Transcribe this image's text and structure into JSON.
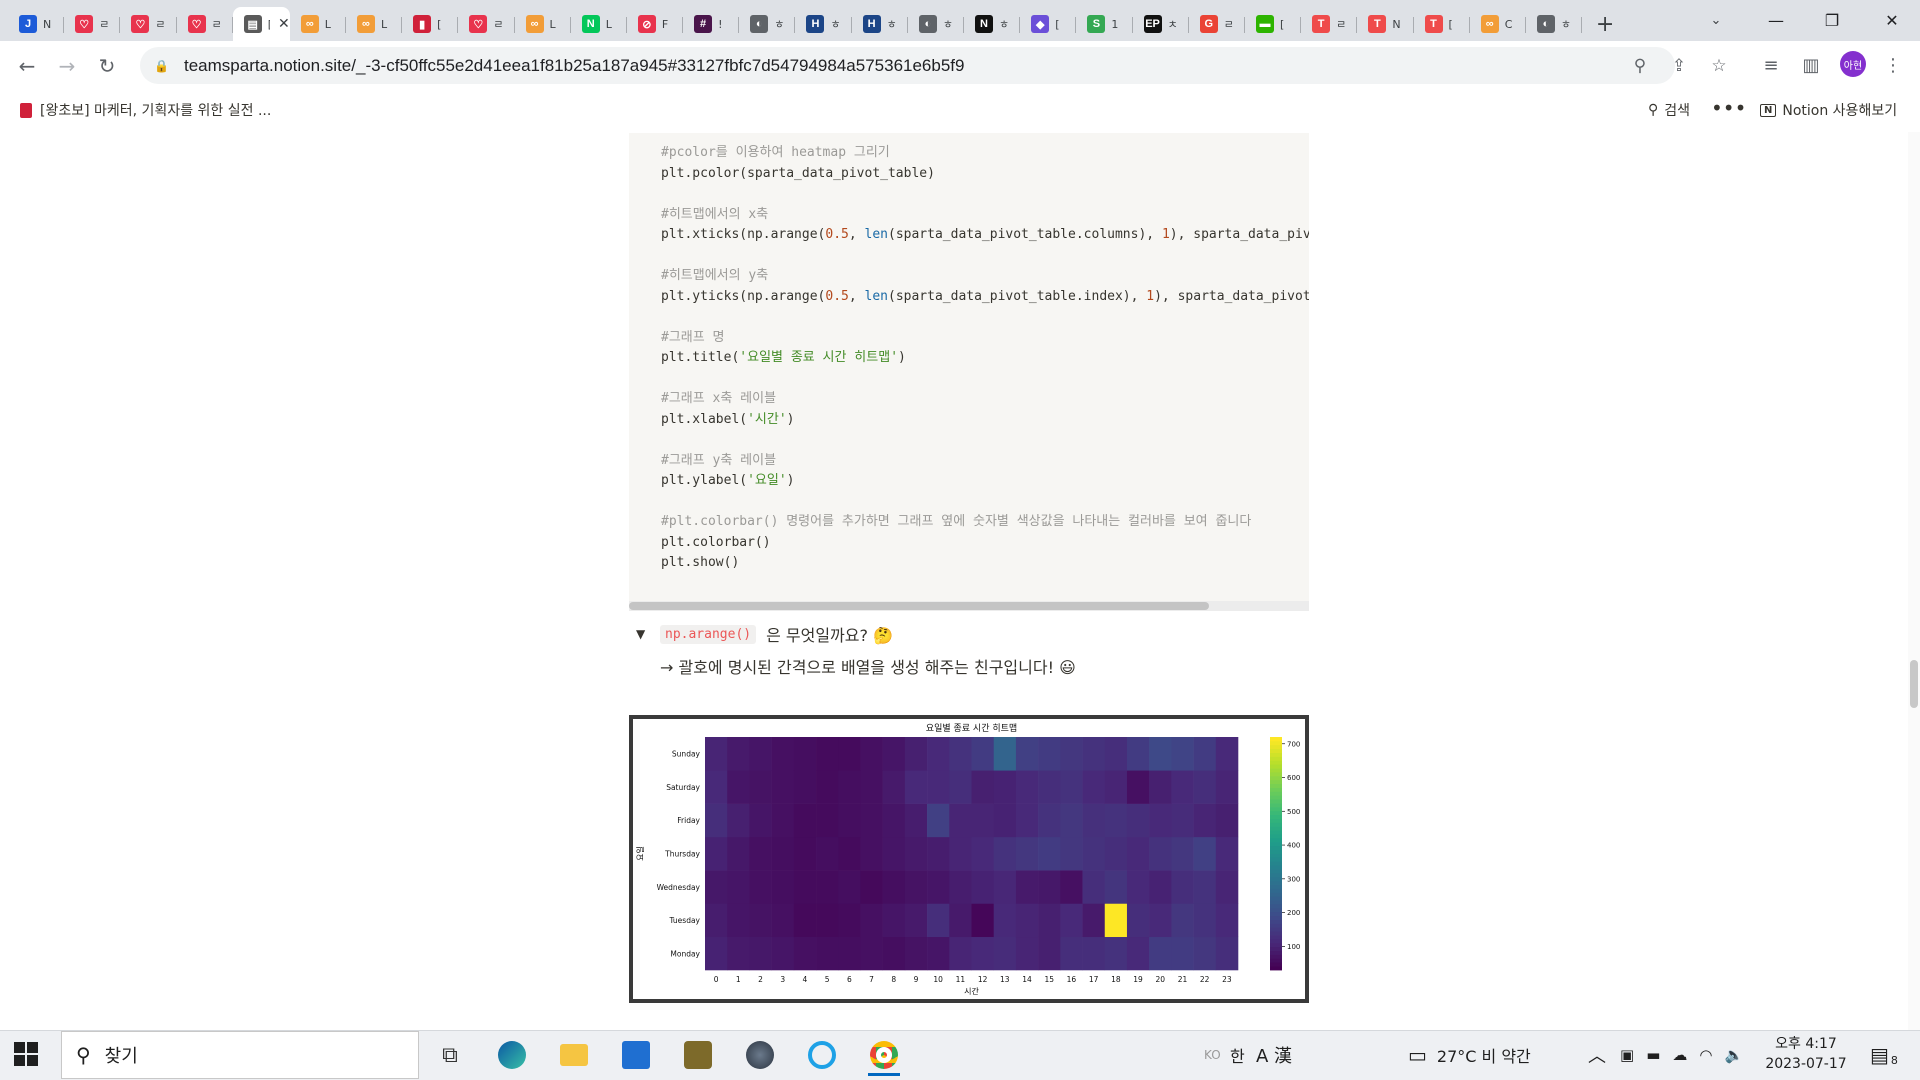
{
  "browser": {
    "tabs": [
      {
        "label": "N",
        "favicon": "J",
        "color": "#1d5bd8",
        "active": false
      },
      {
        "label": "ㄹ",
        "favicon": "♡",
        "color": "#e8334d",
        "active": false
      },
      {
        "label": "ㄹ",
        "favicon": "♡",
        "color": "#e8334d",
        "active": false
      },
      {
        "label": "ㄹ",
        "favicon": "♡",
        "color": "#e8334d",
        "active": false
      },
      {
        "label": "[왕",
        "favicon": "▤",
        "color": "#5a5a5a",
        "active": true
      },
      {
        "label": "L",
        "favicon": "∞",
        "color": "#f29d38",
        "active": false
      },
      {
        "label": "L",
        "favicon": "∞",
        "color": "#f29d38",
        "active": false
      },
      {
        "label": "[",
        "favicon": "▮",
        "color": "#d0213a",
        "active": false
      },
      {
        "label": "ㄹ",
        "favicon": "♡",
        "color": "#e8334d",
        "active": false
      },
      {
        "label": "L",
        "favicon": "∞",
        "color": "#f29d38",
        "active": false
      },
      {
        "label": "L",
        "favicon": "N",
        "color": "#03c75a",
        "active": false
      },
      {
        "label": "F",
        "favicon": "⊘",
        "color": "#e8334d",
        "active": false
      },
      {
        "label": "!",
        "favicon": "#",
        "color": "#4a154b",
        "active": false
      },
      {
        "label": "ㅎ",
        "favicon": "◐",
        "color": "#5f6368",
        "active": false
      },
      {
        "label": "ㅎ",
        "favicon": "H",
        "color": "#1c4587",
        "active": false
      },
      {
        "label": "ㅎ",
        "favicon": "H",
        "color": "#1c4587",
        "active": false
      },
      {
        "label": "ㅎ",
        "favicon": "◐",
        "color": "#5f6368",
        "active": false
      },
      {
        "label": "ㅎ",
        "favicon": "N",
        "color": "#111111",
        "active": false
      },
      {
        "label": "[",
        "favicon": "◆",
        "color": "#6b4fd8",
        "active": false
      },
      {
        "label": "1",
        "favicon": "S",
        "color": "#34a853",
        "active": false
      },
      {
        "label": "ㅊ",
        "favicon": "EP",
        "color": "#111111",
        "active": false
      },
      {
        "label": "ㄹ",
        "favicon": "G",
        "color": "#ea4335",
        "active": false
      },
      {
        "label": "[",
        "favicon": "▬",
        "color": "#2db400",
        "active": false
      },
      {
        "label": "ㄹ",
        "favicon": "T",
        "color": "#ef4b4b",
        "active": false
      },
      {
        "label": "N",
        "favicon": "T",
        "color": "#ef4b4b",
        "active": false
      },
      {
        "label": "[",
        "favicon": "T",
        "color": "#ef4b4b",
        "active": false
      },
      {
        "label": "C",
        "favicon": "∞",
        "color": "#f29d38",
        "active": false
      },
      {
        "label": "ㅎ",
        "favicon": "◐",
        "color": "#5f6368",
        "active": false
      }
    ],
    "url": "teamsparta.notion.site/_-3-cf50ffc55e2d41eea1f81b25a187a945#33127fbfc7d54794984a575361e6b5f9",
    "profile_initials": "아현"
  },
  "notion": {
    "breadcrumb": "[왕초보] 마케터, 기획자를 위한 실전 ...",
    "search_label": "검색",
    "try_notion_label": "Notion 사용해보기"
  },
  "code": {
    "lines": [
      [
        {
          "t": "#pcolor를 이용하여 heatmap 그리기",
          "c": "cm"
        }
      ],
      [
        {
          "t": "plt.pcolor(sparta_data_pivot_table)",
          "c": ""
        }
      ],
      [],
      [
        {
          "t": "#히트맵에서의 x축",
          "c": "cm"
        }
      ],
      [
        {
          "t": "plt.xticks(np.arange(",
          "c": ""
        },
        {
          "t": "0.5",
          "c": "num"
        },
        {
          "t": ", ",
          "c": ""
        },
        {
          "t": "len",
          "c": "fn"
        },
        {
          "t": "(sparta_data_pivot_table.columns), ",
          "c": ""
        },
        {
          "t": "1",
          "c": "num"
        },
        {
          "t": "), sparta_data_pivot_table.columns)",
          "c": ""
        }
      ],
      [],
      [
        {
          "t": "#히트맵에서의 y축",
          "c": "cm"
        }
      ],
      [
        {
          "t": "plt.yticks(np.arange(",
          "c": ""
        },
        {
          "t": "0.5",
          "c": "num"
        },
        {
          "t": ", ",
          "c": ""
        },
        {
          "t": "len",
          "c": "fn"
        },
        {
          "t": "(sparta_data_pivot_table.index), ",
          "c": ""
        },
        {
          "t": "1",
          "c": "num"
        },
        {
          "t": "), sparta_data_pivot_table.index)",
          "c": ""
        }
      ],
      [],
      [
        {
          "t": "#그래프 명",
          "c": "cm"
        }
      ],
      [
        {
          "t": "plt.title(",
          "c": ""
        },
        {
          "t": "'요일별 종료 시간 히트맵'",
          "c": "str"
        },
        {
          "t": ")",
          "c": ""
        }
      ],
      [],
      [
        {
          "t": "#그래프 x축 레이블",
          "c": "cm"
        }
      ],
      [
        {
          "t": "plt.xlabel(",
          "c": ""
        },
        {
          "t": "'시간'",
          "c": "str"
        },
        {
          "t": ")",
          "c": ""
        }
      ],
      [],
      [
        {
          "t": "#그래프 y축 레이블",
          "c": "cm"
        }
      ],
      [
        {
          "t": "plt.ylabel(",
          "c": ""
        },
        {
          "t": "'요일'",
          "c": "str"
        },
        {
          "t": ")",
          "c": ""
        }
      ],
      [],
      [
        {
          "t": "#plt.colorbar() 명령어를 추가하면 그래프 옆에 숫자별 색상값을 나타내는 컬러바를 보여 줍니다",
          "c": "cm"
        }
      ],
      [
        {
          "t": "plt.colorbar()",
          "c": ""
        }
      ],
      [
        {
          "t": "plt.show()",
          "c": ""
        }
      ]
    ]
  },
  "toggle": {
    "code_label": "np.arange()",
    "question": "은 무엇일까요? 🤔",
    "answer": "→ 괄호에 명시된 간격으로 배열을 생성 해주는 친구입니다! 😃"
  },
  "chart_data": {
    "type": "heatmap",
    "title": "요일별 종료 시간 히트맵",
    "xlabel": "시간",
    "ylabel": "요일",
    "x": [
      "0",
      "1",
      "2",
      "3",
      "4",
      "5",
      "6",
      "7",
      "8",
      "9",
      "10",
      "11",
      "12",
      "13",
      "14",
      "15",
      "16",
      "17",
      "18",
      "19",
      "20",
      "21",
      "22",
      "23"
    ],
    "y": [
      "Monday",
      "Tuesday",
      "Wednesday",
      "Thursday",
      "Friday",
      "Saturday",
      "Sunday"
    ],
    "values": [
      [
        95,
        80,
        75,
        70,
        60,
        55,
        55,
        60,
        55,
        65,
        70,
        100,
        110,
        115,
        100,
        90,
        120,
        120,
        130,
        110,
        150,
        150,
        140,
        120
      ],
      [
        85,
        70,
        65,
        60,
        45,
        45,
        50,
        60,
        70,
        80,
        120,
        80,
        40,
        110,
        100,
        90,
        110,
        80,
        720,
        120,
        110,
        140,
        130,
        110
      ],
      [
        75,
        70,
        60,
        55,
        50,
        50,
        55,
        45,
        55,
        65,
        70,
        85,
        95,
        105,
        80,
        75,
        60,
        120,
        135,
        110,
        95,
        120,
        130,
        100
      ],
      [
        95,
        75,
        60,
        55,
        50,
        55,
        50,
        60,
        70,
        80,
        85,
        100,
        110,
        130,
        140,
        150,
        140,
        130,
        120,
        110,
        130,
        140,
        160,
        110
      ],
      [
        120,
        90,
        70,
        60,
        50,
        50,
        55,
        60,
        70,
        85,
        160,
        100,
        100,
        95,
        110,
        130,
        140,
        125,
        130,
        120,
        110,
        115,
        100,
        90
      ],
      [
        110,
        70,
        65,
        60,
        55,
        50,
        55,
        60,
        80,
        110,
        110,
        120,
        90,
        95,
        110,
        120,
        130,
        110,
        100,
        60,
        90,
        110,
        120,
        100
      ],
      [
        100,
        80,
        70,
        60,
        55,
        50,
        50,
        60,
        70,
        90,
        110,
        130,
        150,
        250,
        160,
        150,
        140,
        130,
        120,
        150,
        180,
        170,
        150,
        110
      ]
    ],
    "colorbar_ticks": [
      100,
      200,
      300,
      400,
      500,
      600,
      700
    ],
    "vmin": 30,
    "vmax": 720,
    "colormap": "viridis"
  },
  "taskbar": {
    "search_placeholder": "찾기",
    "ime_ko": "KO",
    "ime_han": "한",
    "weather": "27°C  비 약간",
    "time": "오후 4:17",
    "date": "2023-07-17",
    "notification_count": "8"
  }
}
